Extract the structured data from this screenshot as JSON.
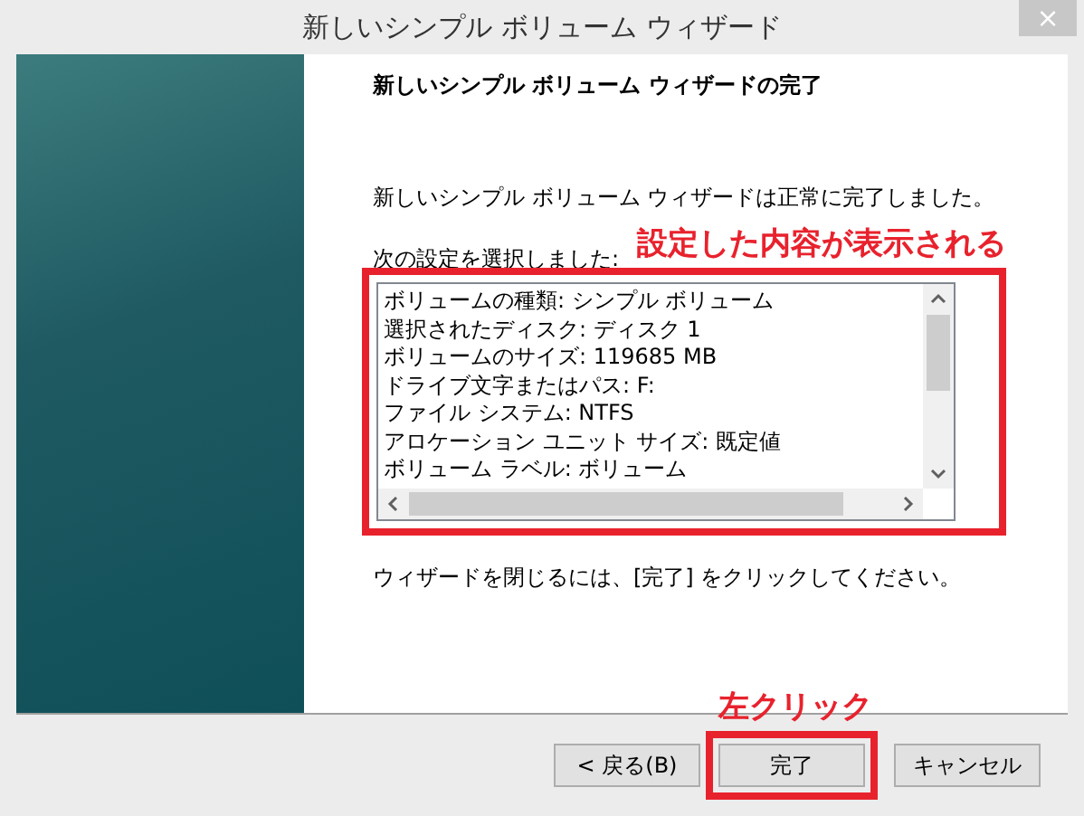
{
  "window": {
    "title": "新しいシンプル ボリューム ウィザード",
    "close": "×"
  },
  "page": {
    "heading": "新しいシンプル ボリューム ウィザードの完了",
    "message": "新しいシンプル ボリューム ウィザードは正常に完了しました。",
    "settings_label": "次の設定を選択しました:",
    "settings": [
      "ボリュームの種類: シンプル ボリューム",
      "選択されたディスク: ディスク 1",
      "ボリュームのサイズ: 119685 MB",
      "ドライブ文字またはパス: F:",
      "ファイル システム: NTFS",
      "アロケーション ユニット サイズ: 既定値",
      "ボリューム ラベル: ボリューム"
    ],
    "closing_note": "ウィザードを閉じるには、[完了] をクリックしてください。"
  },
  "buttons": [
    {
      "label": "< 戻る(B)",
      "kind": "back"
    },
    {
      "label": "完了",
      "kind": "finish"
    },
    {
      "label": "キャンセル",
      "kind": "cancel"
    }
  ],
  "annotations": [
    {
      "text": "設定した内容が表示される"
    },
    {
      "text": "左クリック"
    }
  ]
}
